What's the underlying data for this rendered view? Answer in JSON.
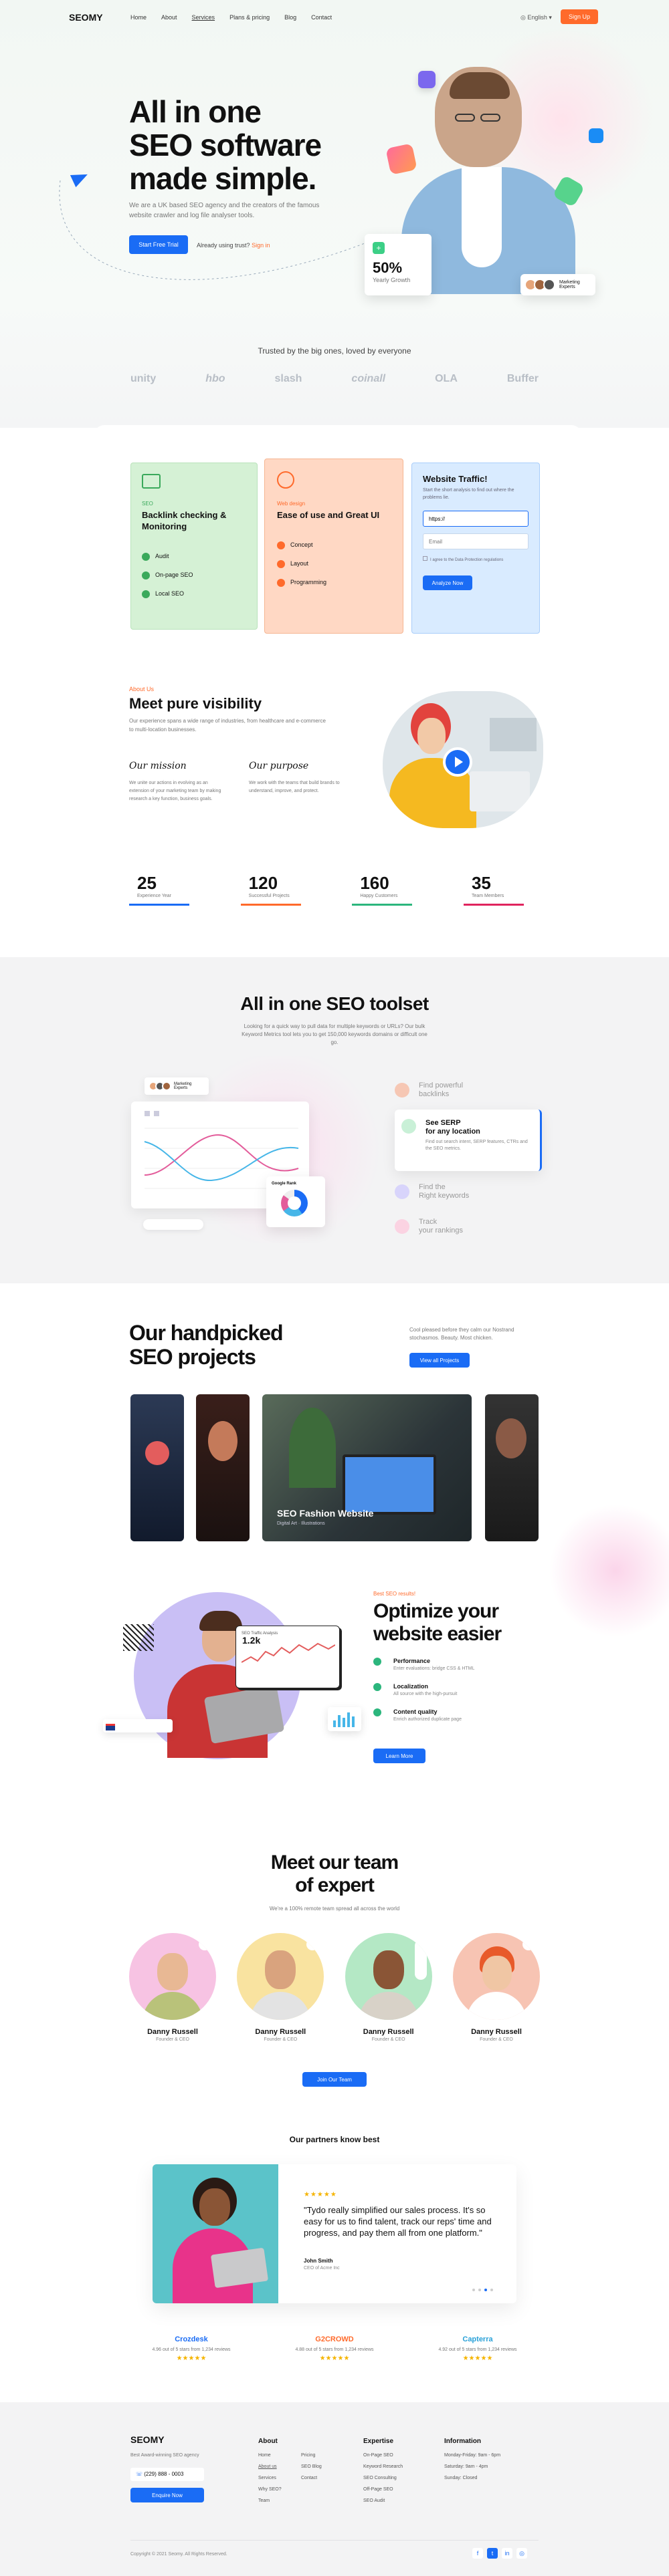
{
  "nav": {
    "logo": "SEOMY",
    "links": [
      "Home",
      "About",
      "Services",
      "Plans & pricing",
      "Blog",
      "Contact"
    ],
    "lang": "English",
    "signup": "Sign Up"
  },
  "hero": {
    "title": [
      "All in one",
      "SEO software",
      "made simple."
    ],
    "desc": "We are a UK based SEO agency and the creators of the famous website crawler and log file analyser tools.",
    "cta": "Start Free Trial",
    "already": "Already using trust?",
    "signin": "Sign in",
    "stat": "50%",
    "stat_label": "Yearly Growth",
    "experts": "Marketing Experts"
  },
  "trusted": {
    "title": "Trusted by the big ones, loved by everyone",
    "logos": [
      "unity",
      "hbo",
      "slash",
      "coinall",
      "OLA",
      "Buffer"
    ]
  },
  "features": {
    "card1": {
      "tag": "SEO",
      "title": "Backlink checking & Monitoring",
      "items": [
        "Audit",
        "On-page SEO",
        "Local SEO"
      ]
    },
    "card2": {
      "tag": "Web design",
      "title": "Ease of use and Great UI",
      "items": [
        "Concept",
        "Layout",
        "Programming"
      ]
    },
    "card3": {
      "title": "Website Traffic!",
      "desc": "Start the short analysis to find out where the problems lie.",
      "url_val": "https://",
      "email_ph": "Email",
      "agree": "I agree to the Data Protection regulations",
      "button": "Analyze Now"
    }
  },
  "about": {
    "eyebrow": "About Us",
    "title": "Meet pure visibility",
    "desc": "Our experience spans a wide range of industries, from healthcare and e-commerce to multi-location businesses.",
    "mission_t": "Our mission",
    "mission_d": "We unite our actions in evolving as an extension of your marketing team by making research a key function, business goals.",
    "purpose_t": "Our purpose",
    "purpose_d": "We work with the teams that build brands to understand, improve, and protect."
  },
  "stats": [
    {
      "num": "25",
      "label": "Experience Year",
      "color": "#1a6cf5"
    },
    {
      "num": "120",
      "label": "Successful Projects",
      "color": "#ff6a2b"
    },
    {
      "num": "160",
      "label": "Happy Customers",
      "color": "#2cb67d"
    },
    {
      "num": "35",
      "label": "Team Members",
      "color": "#e0245e"
    }
  ],
  "toolset": {
    "title": "All in one SEO toolset",
    "desc": "Looking for a quick way to pull data for multiple keywords or URLs? Our bulk Keyword Metrics tool lets you to get 150,000 keywords domains or difficult one go.",
    "chart_label": "Marketing Experts",
    "donut_title": "Google Rank",
    "donut_val": "",
    "features": [
      {
        "t": "Find powerful",
        "t2": "backlinks"
      },
      {
        "t": "See SERP",
        "t2": "for any location",
        "d": "Find out search intent, SERP features, CTRs and the SEO metrics."
      },
      {
        "t": "Find the",
        "t2": "Right keywords"
      },
      {
        "t": "Track",
        "t2": "your rankings"
      }
    ]
  },
  "projects": {
    "title": [
      "Our handpicked",
      "SEO projects"
    ],
    "desc": "Cool pleased before they calm our Nostrand stochasmos. Beauty. Most chicken.",
    "button": "View all Projects",
    "feature_title": "SEO Fashion Website",
    "feature_sub": "Digital Art · Illustrations"
  },
  "optimize": {
    "eyebrow": "Best SEO results!",
    "title": [
      "Optimize your",
      "website easier"
    ],
    "items": [
      {
        "t": "Performance",
        "d": "Enter evaluations: bridge CSS & HTML"
      },
      {
        "t": "Localization",
        "d": "All source with the high-pursuit"
      },
      {
        "t": "Content quality",
        "d": "Enrich authorized duplicate page"
      }
    ],
    "button": "Learn More",
    "stat": "1.2k",
    "card_label": "SEO Traffic Analysis"
  },
  "team": {
    "title": [
      "Meet our team",
      "of expert"
    ],
    "desc": "We're a 100% remote team spread all across the world",
    "members": [
      {
        "name": "Danny Russell",
        "role": "Founder & CEO",
        "bg": "#f7c3e3"
      },
      {
        "name": "Danny Russell",
        "role": "Founder & CEO",
        "bg": "#f9e3a0"
      },
      {
        "name": "Danny Russell",
        "role": "Founder & CEO",
        "bg": "#b4e8c5"
      },
      {
        "name": "Danny Russell",
        "role": "Founder & CEO",
        "bg": "#f7c4b3"
      }
    ],
    "button": "Join Our Team"
  },
  "partners": {
    "title": "Our partners know best",
    "quote": "\"Tydo really simplified our sales process. It's so easy for us to find talent, track our reps' time and progress, and pay them all from one platform.\"",
    "author": "John Smith",
    "author_role": "CEO of Acme Inc",
    "stars": "★★★★★"
  },
  "reviews": [
    {
      "brand": "Crozdesk",
      "text": "4.96 out of 5 stars from 1,234 reviews",
      "color": "#1a6cf5"
    },
    {
      "brand": "G2CROWD",
      "text": "4.88 out of 5 stars from 1,234 reviews",
      "color": "#ff6a2b"
    },
    {
      "brand": "Capterra",
      "text": "4.92 out of 5 stars from 1,234 reviews",
      "color": "#2aa1d8"
    }
  ],
  "footer": {
    "logo": "SEOMY",
    "tagline": "Best Award-winning SEO agency",
    "phone": "(229) 888 - 0003",
    "button": "Enquire Now",
    "cols": [
      {
        "t": "About",
        "items": [
          "Home",
          "About us",
          "Services",
          "Why SEO?",
          "Team"
        ]
      },
      {
        "t": "",
        "items": [
          "Pricing",
          "SEO Blog",
          "Contact"
        ]
      },
      {
        "t": "Expertise",
        "items": [
          "On-Page SEO",
          "Keyword Research",
          "SEO Consulting",
          "Off-Page SEO",
          "SEO Audit"
        ]
      },
      {
        "t": "Information",
        "items": [
          "Monday-Friday: 9am - 6pm",
          "Saturday: 9am - 4pm",
          "Sunday: Closed"
        ]
      }
    ],
    "copyright": "Copyright © 2021 Seomy. All Rights Reserved."
  }
}
